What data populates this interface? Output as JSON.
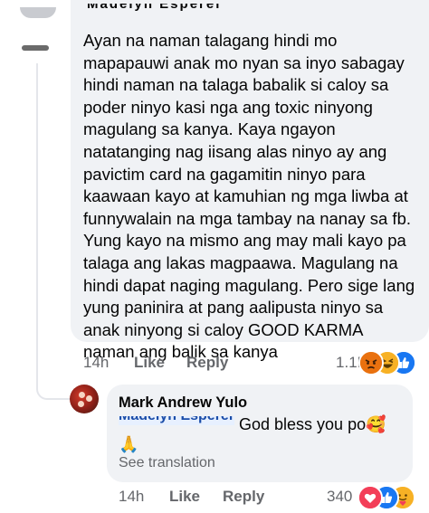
{
  "comment": {
    "author_obscured": "Madelyn Esperel",
    "text": "Ayan na naman talagang hindi mo mapapauwi anak mo nyan sa inyo sabagay hindi naman na talaga babalik si caloy sa poder ninyo kasi nga ang toxic ninyong magulang sa kanya. Kaya ngayon natatanging nag iisang alas ninyo ay ang pavictim card na gagamitin ninyo para kaawaan kayo at kamuhian ng mga liwba at funnywalain na mga tambay na nanay sa fb. Yung kayo na mismo ang may mali kayo pa talaga ang lakas magpaawa. Magulang na hindi dapat naging magulang. Pero sige lang yung paninira at pang aalipusta ninyo sa anak ninyong si caloy GOOD KARMA naman ang balik sa kanya",
    "time": "14h",
    "like_label": "Like",
    "reply_label": "Reply",
    "reaction_count": "1.1K",
    "reaction_icons": [
      "angry-icon",
      "haha-icon",
      "like-icon"
    ]
  },
  "reply": {
    "author": "Mark Andrew Yulo",
    "mention": "Madelyn Esperel",
    "text": "God bless you po",
    "emojis": [
      "🥰",
      "🙏"
    ],
    "see_translation": "See translation",
    "time": "14h",
    "like_label": "Like",
    "reply_label": "Reply",
    "reaction_count": "340",
    "reaction_icons": [
      "love-icon",
      "like-icon",
      "care-icon"
    ]
  },
  "colors": {
    "bubble": "#f0f2f5",
    "secondary_text": "#65676b",
    "like_blue": "#1877f2",
    "love_red": "#f33e58",
    "angry_orange": "#e9710f",
    "haha_yellow": "#f7b125"
  }
}
